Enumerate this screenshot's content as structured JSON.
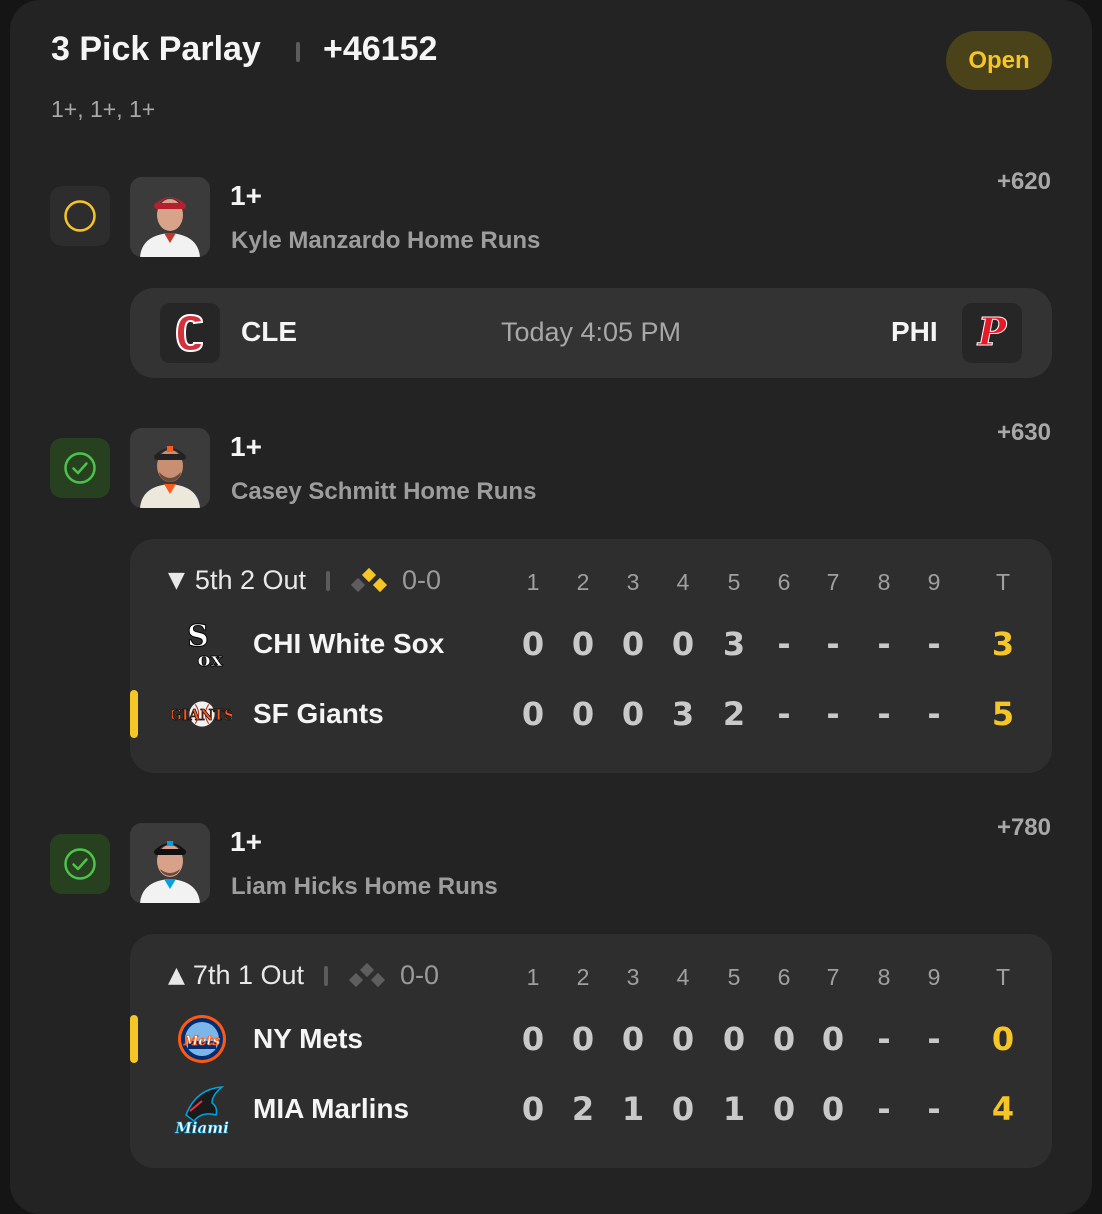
{
  "header": {
    "title": "3 Pick Parlay",
    "odds": "+46152",
    "subtitle": "1+, 1+, 1+",
    "status": "Open"
  },
  "colors": {
    "accent": "#f6c526",
    "win_green": "#4cc34a",
    "card_bg": "#232323"
  },
  "legs": [
    {
      "status_icon": "open-circle-icon",
      "line": "1+",
      "market": "Kyle Manzardo Home Runs",
      "odds": "+620",
      "game": {
        "away": "CLE",
        "home": "PHI",
        "time": "Today 4:05 PM"
      }
    },
    {
      "status_icon": "check-circle-icon",
      "line": "1+",
      "market": "Casey Schmitt Home Runs",
      "odds": "+630",
      "scoreboard": {
        "arrow": "▼",
        "inning": "5th 2 Out",
        "count": "0-0",
        "columns": [
          "1",
          "2",
          "3",
          "4",
          "5",
          "6",
          "7",
          "8",
          "9",
          "T"
        ],
        "rows": [
          {
            "team": "CHI White Sox",
            "batting": false,
            "cells": [
              "0",
              "0",
              "0",
              "0",
              "3",
              "-",
              "-",
              "-",
              "-",
              "3"
            ]
          },
          {
            "team": "SF Giants",
            "batting": true,
            "cells": [
              "0",
              "0",
              "0",
              "3",
              "2",
              "-",
              "-",
              "-",
              "-",
              "5"
            ]
          }
        ]
      }
    },
    {
      "status_icon": "check-circle-icon",
      "line": "1+",
      "market": "Liam Hicks Home Runs",
      "odds": "+780",
      "scoreboard": {
        "arrow": "▲",
        "inning": "7th 1 Out",
        "count": "0-0",
        "columns": [
          "1",
          "2",
          "3",
          "4",
          "5",
          "6",
          "7",
          "8",
          "9",
          "T"
        ],
        "rows": [
          {
            "team": "NY Mets",
            "batting": true,
            "cells": [
              "0",
              "0",
              "0",
              "0",
              "0",
              "0",
              "0",
              "-",
              "-",
              "0"
            ]
          },
          {
            "team": "MIA Marlins",
            "batting": false,
            "cells": [
              "0",
              "2",
              "1",
              "0",
              "1",
              "0",
              "0",
              "-",
              "-",
              "4"
            ]
          }
        ]
      }
    }
  ]
}
